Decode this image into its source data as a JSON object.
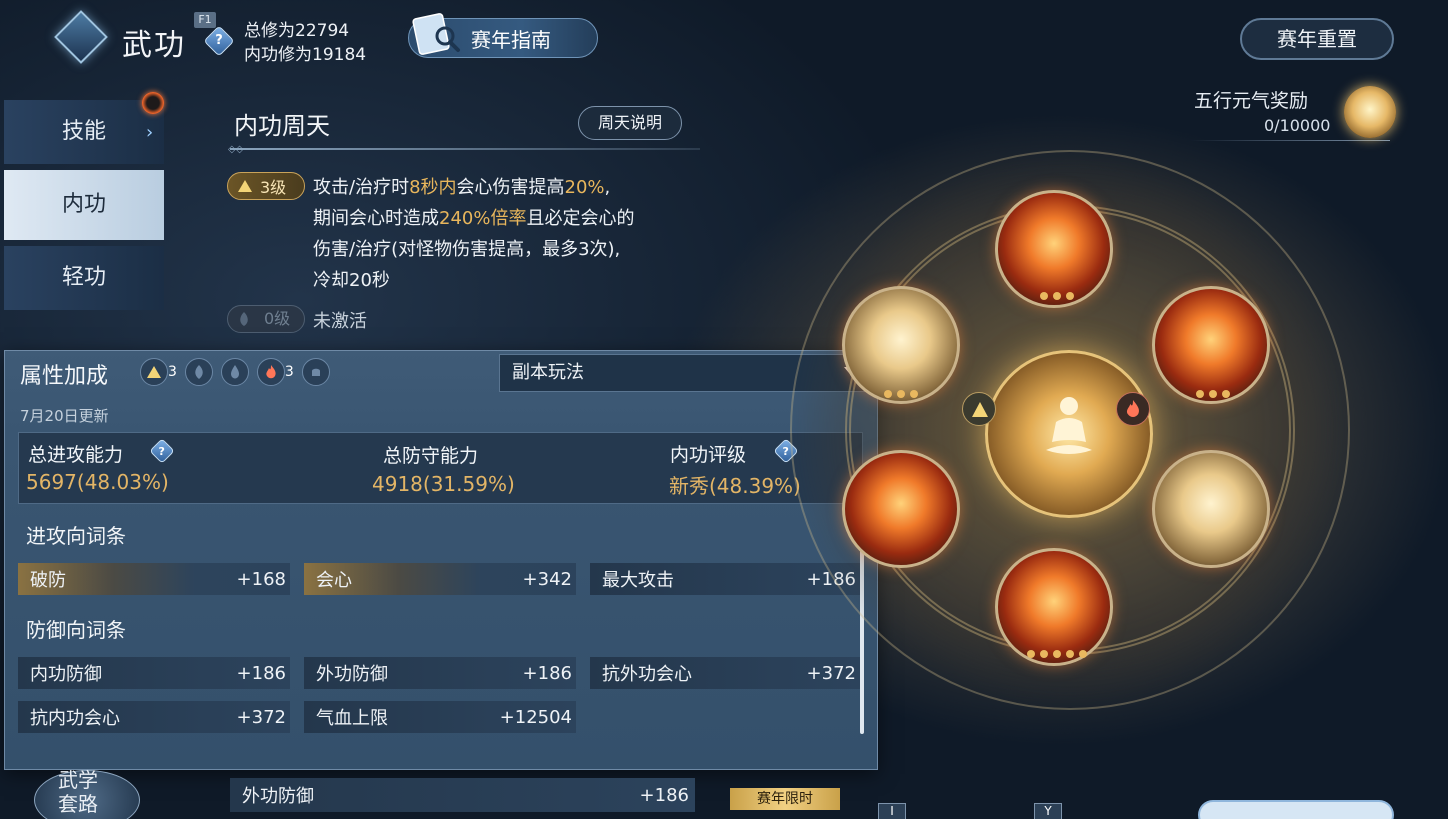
{
  "header": {
    "title": "武功",
    "key_hint": "F1",
    "help_icon": "?",
    "total_cultivation": "总修为22794",
    "neigong_cultivation": "内功修为19184",
    "guide_button": "赛年指南",
    "reset_button": "赛年重置"
  },
  "reward": {
    "label": "五行元气奖励",
    "count": "0/10000"
  },
  "tabs": [
    {
      "label": "技能"
    },
    {
      "label": "内功"
    },
    {
      "label": "轻功"
    }
  ],
  "neigong": {
    "section_title": "内功周天",
    "explain_button": "周天说明",
    "active_level": "3级",
    "desc_line1_a": "攻击/治疗时",
    "desc_line1_hl1": "8秒内",
    "desc_line1_b": "会心伤害提高",
    "desc_line1_hl2": "20%",
    "desc_line1_c": ",",
    "desc_line2_a": "期间会心时造成",
    "desc_line2_hl": "240%倍率",
    "desc_line2_b": "且必定会心的",
    "desc_line3": "伤害/治疗(对怪物伤害提高，最多3次),",
    "desc_line4": "冷却20秒",
    "inactive_level": "0级",
    "inactive_text": "未激活"
  },
  "panel": {
    "title": "属性加成",
    "elements": [
      {
        "icon": "mountain-icon",
        "count": "3"
      },
      {
        "icon": "leaf-icon",
        "count": ""
      },
      {
        "icon": "water-icon",
        "count": ""
      },
      {
        "icon": "fire-icon",
        "count": "3"
      },
      {
        "icon": "bell-icon",
        "count": ""
      }
    ],
    "dropdown_value": "副本玩法",
    "update_date": "7月20日更新",
    "summary": {
      "attack_label": "总进攻能力",
      "attack_value": "5697(48.03%)",
      "defense_label": "总防守能力",
      "defense_value": "4918(31.59%)",
      "rating_label": "内功评级",
      "rating_value": "新秀(48.39%)"
    },
    "attack_group_title": "进攻向词条",
    "attack_stats": [
      {
        "name": "破防",
        "value": "+168"
      },
      {
        "name": "会心",
        "value": "+342"
      },
      {
        "name": "最大攻击",
        "value": "+186"
      }
    ],
    "defense_group_title": "防御向词条",
    "defense_stats": [
      {
        "name": "内功防御",
        "value": "+186"
      },
      {
        "name": "外功防御",
        "value": "+186"
      },
      {
        "name": "抗外功会心",
        "value": "+372"
      },
      {
        "name": "抗内功会心",
        "value": "+372"
      },
      {
        "name": "气血上限",
        "value": "+12504"
      }
    ]
  },
  "bottom": {
    "row_name": "外功防御",
    "row_value": "+186",
    "wuxue_line1": "武学",
    "wuxue_line2": "套路",
    "season_tag": "赛年限时",
    "key_i": "I",
    "key_y": "Y"
  },
  "colors": {
    "gold_highlight": "#e8b65c",
    "panel_bg": "#3a5672",
    "accent_blue": "#6f94b8"
  }
}
